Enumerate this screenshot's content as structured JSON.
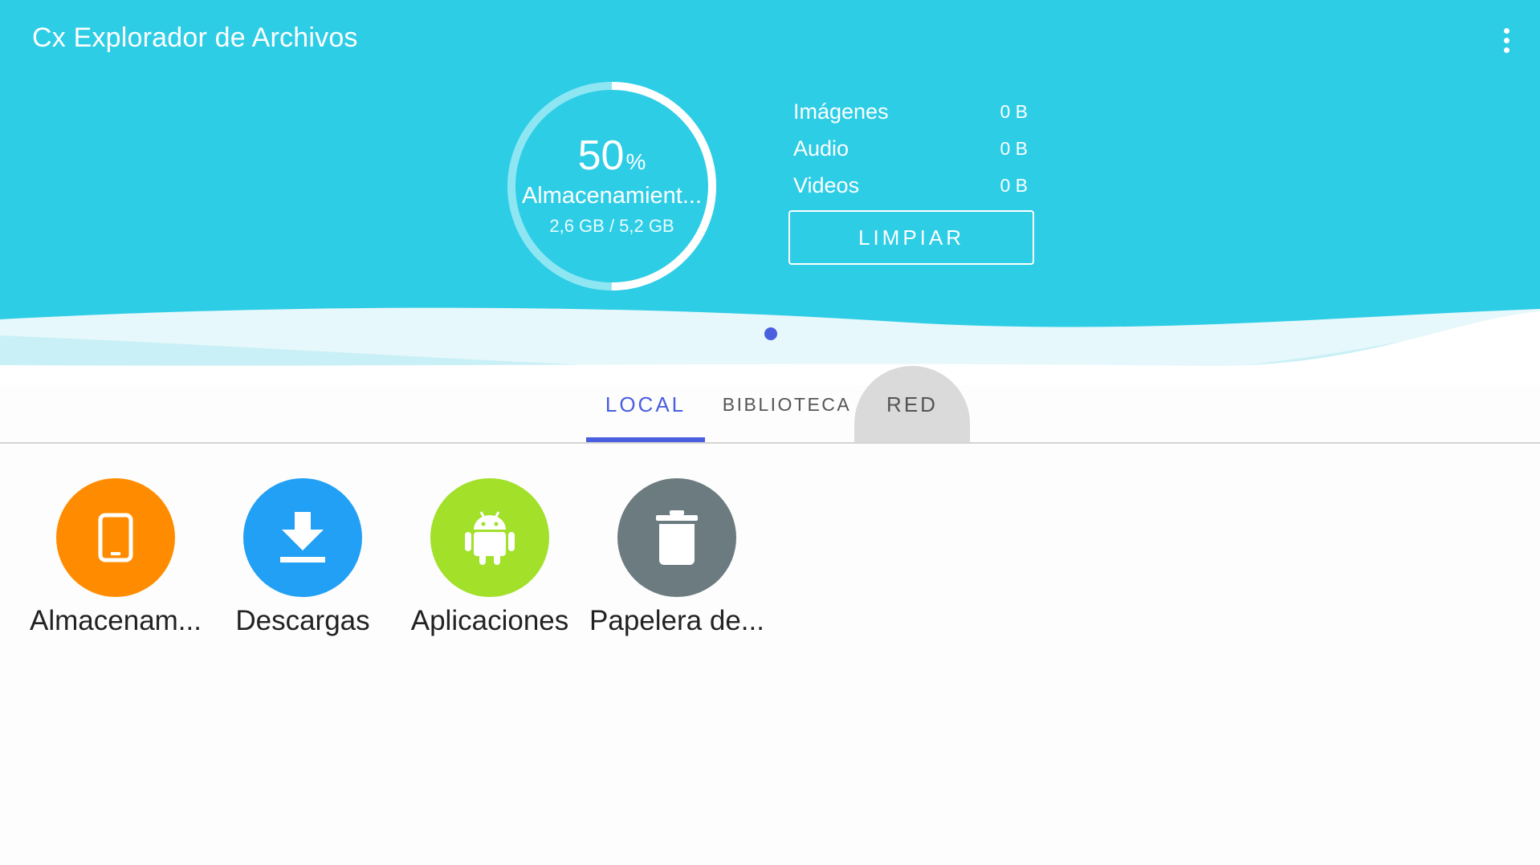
{
  "app": {
    "title": "Cx Explorador de Archivos"
  },
  "storage": {
    "percent": "50",
    "percent_sign": "%",
    "usage_fraction": 0.5,
    "name": "Almacenamient...",
    "size": "2,6 GB / 5,2 GB"
  },
  "stats": [
    {
      "label": "Imágenes",
      "value": "0 B"
    },
    {
      "label": "Audio",
      "value": "0 B"
    },
    {
      "label": "Videos",
      "value": "0 B"
    }
  ],
  "clean_button": {
    "label": "LIMPIAR"
  },
  "tabs": [
    {
      "label": "LOCAL",
      "selected": true
    },
    {
      "label": "BIBLIOTECA",
      "selected": false
    },
    {
      "label": "RED",
      "selected": false,
      "pressed": true
    }
  ],
  "shortcuts": [
    {
      "label": "Almacenam...",
      "icon": "tablet-icon",
      "color": "#ff8c00"
    },
    {
      "label": "Descargas",
      "icon": "download-icon",
      "color": "#22a0f5"
    },
    {
      "label": "Aplicaciones",
      "icon": "android-icon",
      "color": "#a2e02a"
    },
    {
      "label": "Papelera de...",
      "icon": "trash-icon",
      "color": "#6b7b80"
    }
  ],
  "colors": {
    "header": "#2ecde6",
    "accent": "#4a5ee0"
  }
}
